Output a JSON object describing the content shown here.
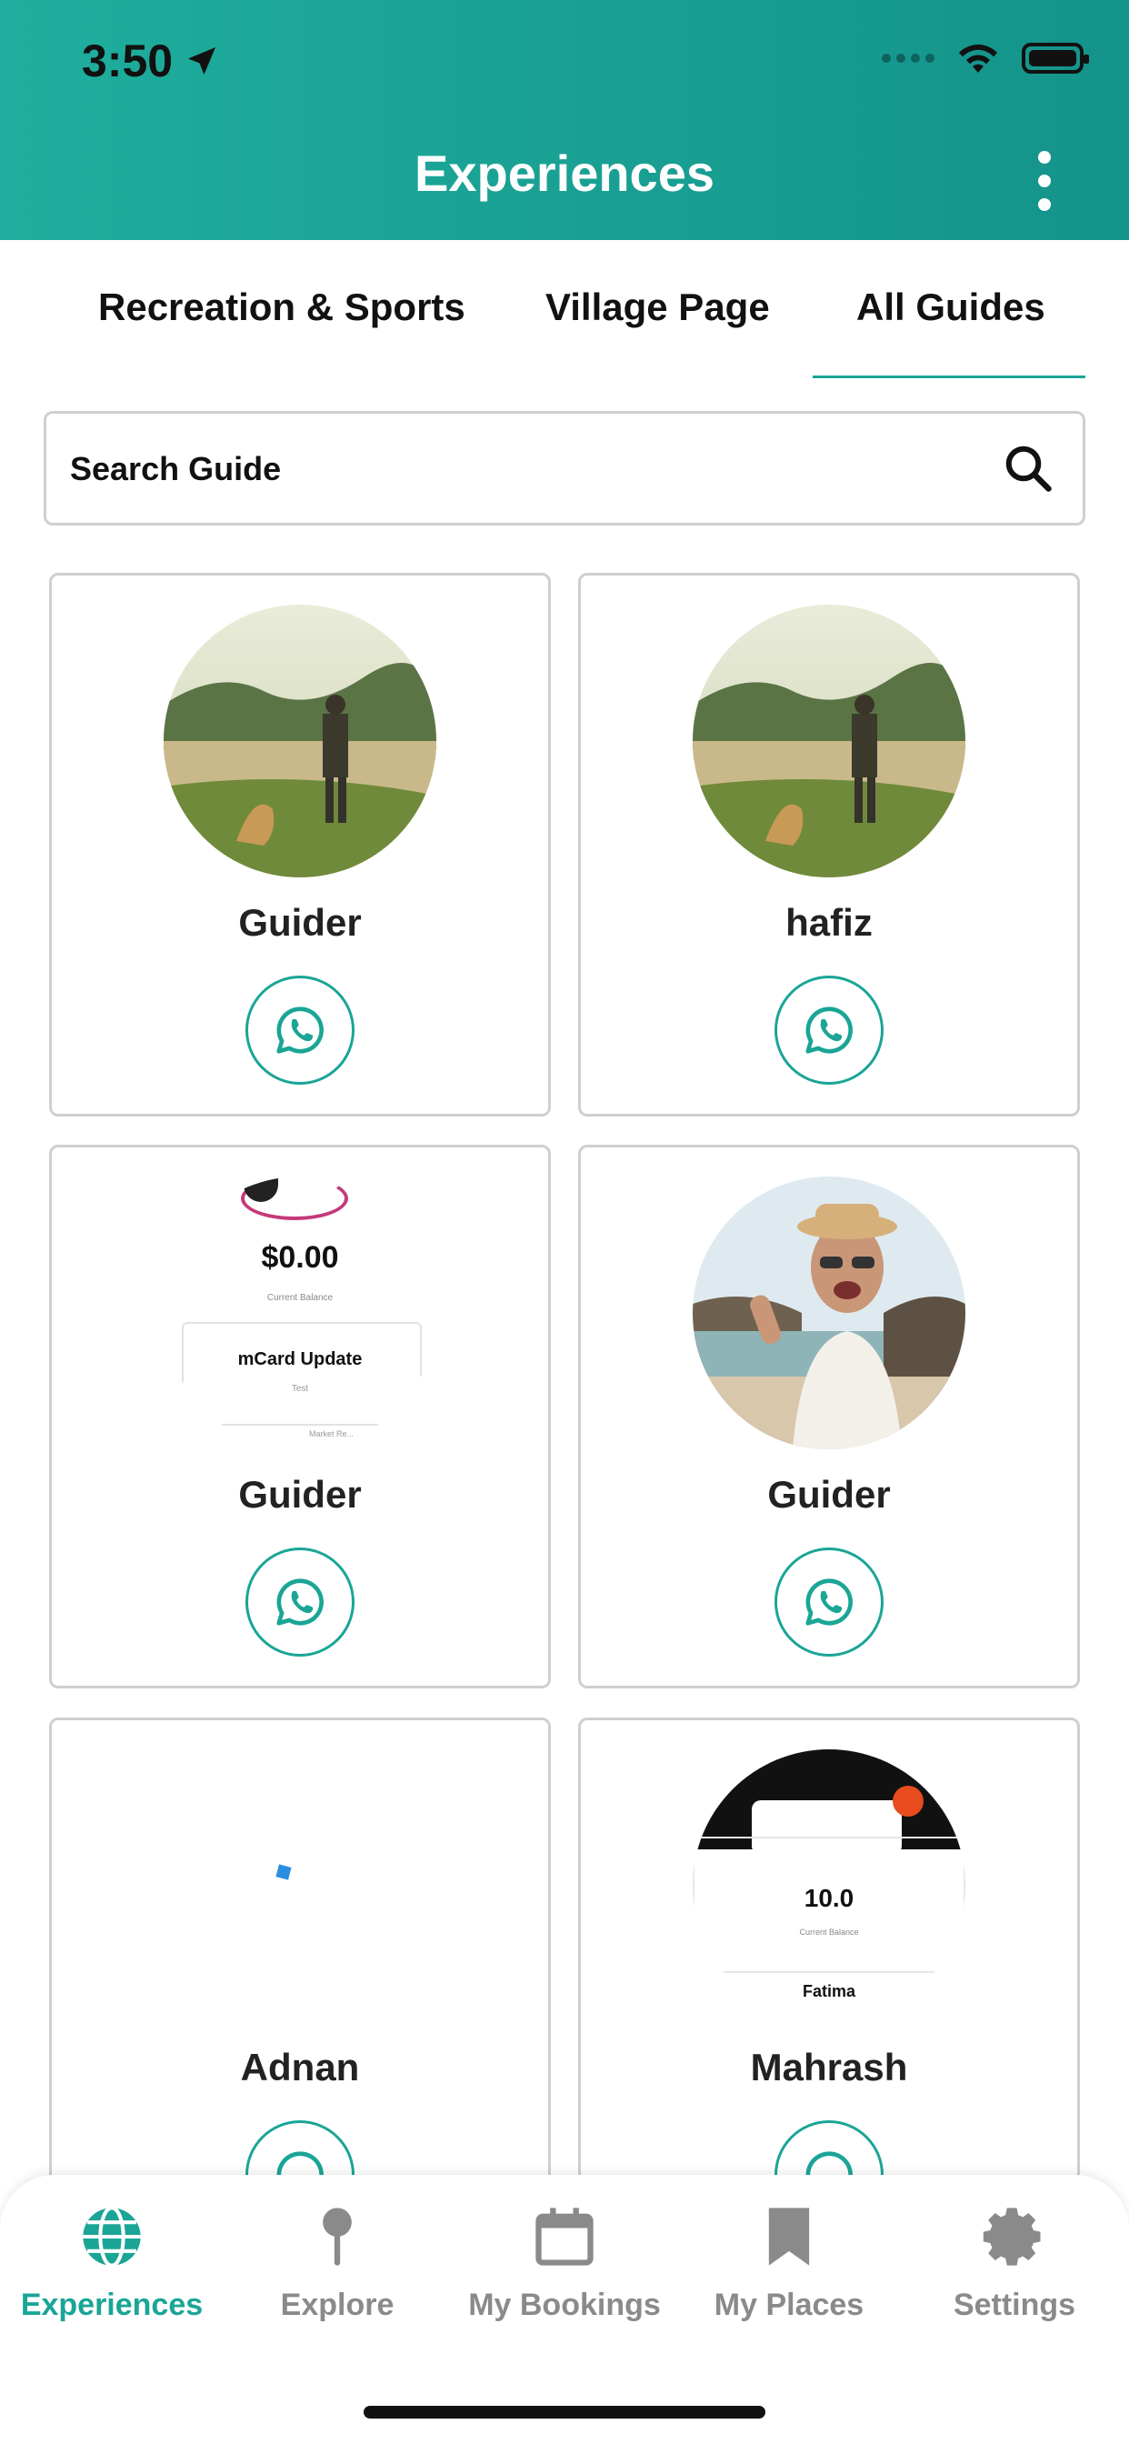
{
  "status_bar": {
    "time": "3:50"
  },
  "header": {
    "title": "Experiences"
  },
  "tabs": [
    {
      "label": "Recreation & Sports",
      "active": false
    },
    {
      "label": "Village Page",
      "active": false
    },
    {
      "label": "All Guides",
      "active": true
    }
  ],
  "search": {
    "placeholder": "Search Guide"
  },
  "guides": [
    {
      "name": "Guider",
      "avatar": "landscape-hiker-photo"
    },
    {
      "name": "hafiz",
      "avatar": "landscape-hiker-photo"
    },
    {
      "name": "Guider",
      "avatar": "app-screenshot",
      "screenshot_amount": "$0.00",
      "screenshot_caption": "Current Balance",
      "screenshot_card_title": "mCard Update",
      "screenshot_card_sub": "Test",
      "screenshot_footer": "Market Re..."
    },
    {
      "name": "Guider",
      "avatar": "selfie-photo"
    },
    {
      "name": "Adnan",
      "avatar": "blank"
    },
    {
      "name": "Mahrash",
      "avatar": "app-screenshot",
      "screenshot_amount": "10.0",
      "screenshot_caption": "Current Balance",
      "screenshot_name": "Fatima"
    }
  ],
  "bottom_nav": [
    {
      "label": "Experiences",
      "icon": "globe-icon",
      "active": true
    },
    {
      "label": "Explore",
      "icon": "pin-icon",
      "active": false
    },
    {
      "label": "My Bookings",
      "icon": "calendar-icon",
      "active": false
    },
    {
      "label": "My Places",
      "icon": "bookmark-icon",
      "active": false
    },
    {
      "label": "Settings",
      "icon": "gear-icon",
      "active": false
    }
  ],
  "colors": {
    "accent": "#1aa596",
    "header_start": "#1fae9d",
    "header_end": "#14938a",
    "inactive": "#8a8a8a"
  }
}
